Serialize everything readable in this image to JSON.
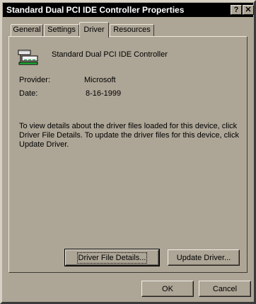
{
  "window": {
    "title": "Standard Dual PCI IDE Controller Properties",
    "help_glyph": "?",
    "close_glyph": "✕"
  },
  "tabs": [
    {
      "label": "General"
    },
    {
      "label": "Settings"
    },
    {
      "label": "Driver"
    },
    {
      "label": "Resources"
    }
  ],
  "device": {
    "icon": "ide-controller-icon",
    "name": "Standard Dual PCI IDE Controller"
  },
  "info": {
    "provider_label": "Provider:",
    "provider_value": "Microsoft",
    "date_label": "Date:",
    "date_value": "8-16-1999"
  },
  "description": "To view details about the driver files loaded for this device, click Driver File Details.  To update the driver files for this device, click Update Driver.",
  "buttons": {
    "driver_file_details": "Driver File Details...",
    "update_driver": "Update Driver...",
    "ok": "OK",
    "cancel": "Cancel"
  }
}
